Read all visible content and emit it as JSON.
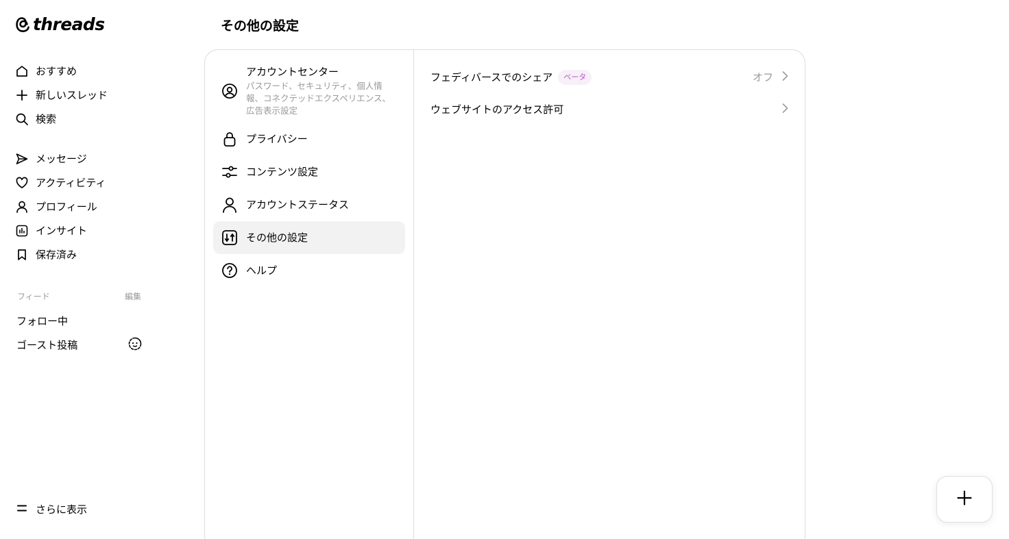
{
  "brand": {
    "name": "threads"
  },
  "nav_primary": [
    {
      "label": "おすすめ",
      "icon": "home-icon"
    },
    {
      "label": "新しいスレッド",
      "icon": "plus-icon"
    },
    {
      "label": "検索",
      "icon": "search-icon"
    }
  ],
  "nav_secondary": [
    {
      "label": "メッセージ",
      "icon": "send-icon"
    },
    {
      "label": "アクティビティ",
      "icon": "heart-icon"
    },
    {
      "label": "プロフィール",
      "icon": "person-icon"
    },
    {
      "label": "インサイト",
      "icon": "insights-icon"
    },
    {
      "label": "保存済み",
      "icon": "bookmark-icon"
    }
  ],
  "feeds": {
    "heading": "フィード",
    "edit_label": "編集",
    "items": [
      {
        "label": "フォロー中"
      },
      {
        "label": "ゴースト投稿",
        "icon": "ghost-icon"
      }
    ]
  },
  "more_label": "さらに表示",
  "page_title": "その他の設定",
  "settings_menu": [
    {
      "label": "アカウントセンター",
      "sub": "パスワード、セキュリティ、個人情報、コネクテッドエクスペリエンス、広告表示設定",
      "icon": "account-circle-icon"
    },
    {
      "label": "プライバシー",
      "icon": "lock-icon"
    },
    {
      "label": "コンテンツ設定",
      "icon": "sliders-icon"
    },
    {
      "label": "アカウントステータス",
      "icon": "person-icon"
    },
    {
      "label": "その他の設定",
      "icon": "settings-box-icon",
      "active": true
    },
    {
      "label": "ヘルプ",
      "icon": "help-icon"
    }
  ],
  "detail_rows": [
    {
      "label": "フェディバースでのシェア",
      "badge": "ベータ",
      "value": "オフ"
    },
    {
      "label": "ウェブサイトのアクセス許可",
      "value": ""
    }
  ],
  "colors": {
    "badge_text": "#b75ac9",
    "badge_bg": "#f7f0f8",
    "active_bg": "#f2f2f2",
    "muted": "#999999"
  }
}
